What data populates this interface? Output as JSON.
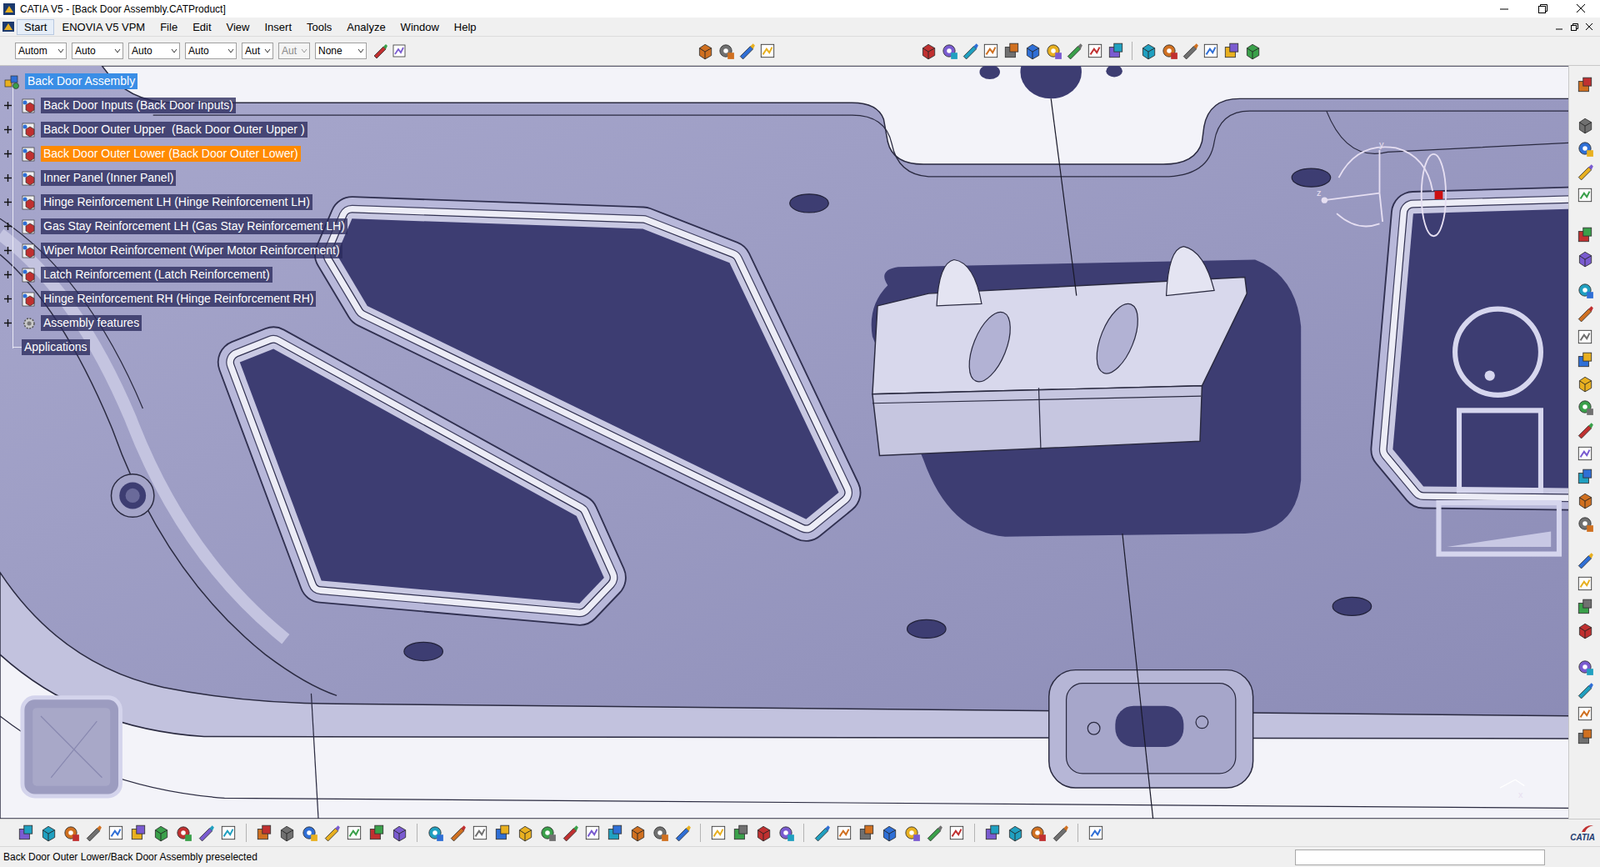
{
  "window": {
    "title": "CATIA V5 - [Back Door Assembly.CATProduct]"
  },
  "menu": [
    "Start",
    "ENOVIA V5 VPM",
    "File",
    "Edit",
    "View",
    "Insert",
    "Tools",
    "Analyze",
    "Window",
    "Help"
  ],
  "toolbar": {
    "dropdowns": [
      {
        "value": "Autom",
        "disabled": false
      },
      {
        "value": "Auto",
        "disabled": false
      },
      {
        "value": "Auto",
        "disabled": false
      },
      {
        "value": "Auto",
        "disabled": false
      },
      {
        "value": "Aut",
        "disabled": false
      },
      {
        "value": "Aut",
        "disabled": true
      },
      {
        "value": "None",
        "disabled": false
      }
    ]
  },
  "tree": {
    "items": [
      {
        "label": "Back Door Assembly",
        "kind": "product",
        "selected": true,
        "preselected": false,
        "expanded": true
      },
      {
        "label": "Back Door Inputs (Back Door Inputs)",
        "kind": "part",
        "selected": false,
        "preselected": false,
        "expanded": false
      },
      {
        "label": "Back Door Outer Upper  (Back Door Outer Upper )",
        "kind": "part",
        "selected": false,
        "preselected": false,
        "expanded": false
      },
      {
        "label": "Back Door Outer Lower (Back Door Outer Lower)",
        "kind": "part",
        "selected": false,
        "preselected": true,
        "expanded": false
      },
      {
        "label": "Inner Panel (Inner Panel)",
        "kind": "part",
        "selected": false,
        "preselected": false,
        "expanded": false
      },
      {
        "label": "Hinge Reinforcement LH (Hinge Reinforcement LH)",
        "kind": "part",
        "selected": false,
        "preselected": false,
        "expanded": false
      },
      {
        "label": "Gas Stay Reinforcement LH (Gas Stay Reinforcement LH)",
        "kind": "part",
        "selected": false,
        "preselected": false,
        "expanded": false
      },
      {
        "label": "Wiper Motor Reinforcement (Wiper Motor Reinforcement)",
        "kind": "part",
        "selected": false,
        "preselected": false,
        "expanded": false
      },
      {
        "label": "Latch Reinforcement (Latch Reinforcement)",
        "kind": "part",
        "selected": false,
        "preselected": false,
        "expanded": false
      },
      {
        "label": "Hinge Reinforcement RH (Hinge Reinforcement RH)",
        "kind": "part",
        "selected": false,
        "preselected": false,
        "expanded": false
      },
      {
        "label": "Assembly features",
        "kind": "features",
        "selected": false,
        "preselected": false,
        "expanded": false
      },
      {
        "label": "Applications",
        "kind": "applications",
        "selected": false,
        "preselected": false
      }
    ]
  },
  "compass": {
    "labels": [
      "y",
      "z"
    ]
  },
  "triad": {
    "label": "x"
  },
  "logo": {
    "text": "CATIA"
  },
  "status_bar": {
    "message": "Back Door Outer Lower/Back Door Assembly preselected"
  }
}
